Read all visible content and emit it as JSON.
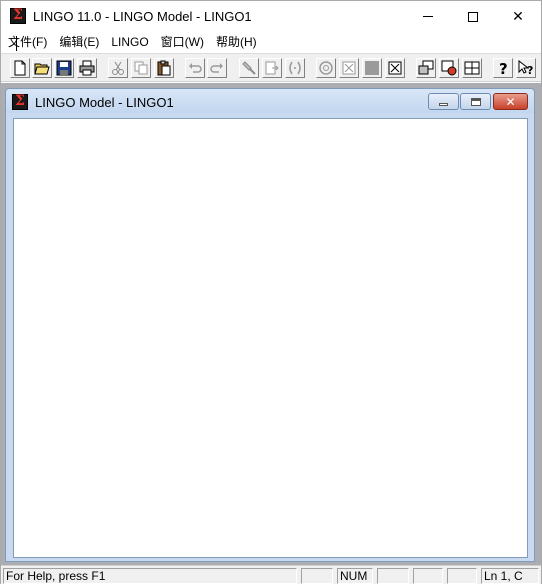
{
  "window": {
    "title": "LINGO 11.0 - LINGO Model - LINGO1",
    "icon": "lingo-sigma-icon",
    "icon_glyph": "Σ",
    "controls": [
      "minimize-icon",
      "maximize-icon",
      "close-icon"
    ],
    "close_glyph": "✕"
  },
  "menu": {
    "items": [
      {
        "label": "文件(F)"
      },
      {
        "label": "编辑(E)"
      },
      {
        "label": "LINGO"
      },
      {
        "label": "窗口(W)"
      },
      {
        "label": "帮助(H)"
      }
    ]
  },
  "toolbar": {
    "buttons": [
      {
        "icon": "new-icon"
      },
      {
        "icon": "open-icon"
      },
      {
        "icon": "save-icon"
      },
      {
        "icon": "print-icon"
      },
      {
        "icon": "cut-icon"
      },
      {
        "icon": "copy-icon"
      },
      {
        "icon": "paste-icon"
      },
      {
        "icon": "undo-icon"
      },
      {
        "icon": "redo-icon"
      },
      {
        "icon": "find-icon"
      },
      {
        "icon": "goto-icon"
      },
      {
        "icon": "match-parenthesis-icon"
      },
      {
        "icon": "solve-icon"
      },
      {
        "icon": "solution-icon"
      },
      {
        "icon": "stop-icon"
      },
      {
        "icon": "close-all-icon"
      },
      {
        "icon": "send-to-back-icon"
      },
      {
        "icon": "options-icon"
      },
      {
        "icon": "tile-icon"
      },
      {
        "icon": "help-icon"
      },
      {
        "icon": "context-help-icon"
      }
    ]
  },
  "child_window": {
    "title": "LINGO Model - LINGO1",
    "icon": "lingo-sigma-icon",
    "close_glyph": "✕"
  },
  "statusbar": {
    "help_text": "For Help, press F1",
    "num_indicator": "NUM",
    "position": "Ln 1, C"
  },
  "colors": {
    "child_title_bg": "#c9daf0",
    "close_button": "#c7402a",
    "toolbar_bg": "#f0f0f0",
    "mdi_bg": "#abadb3"
  }
}
